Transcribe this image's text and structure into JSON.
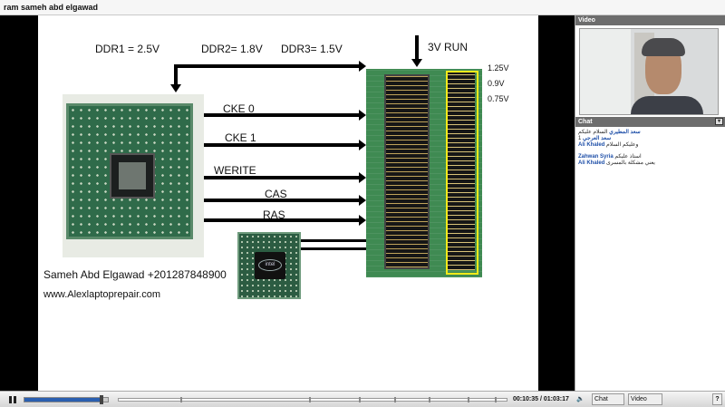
{
  "window": {
    "title": "ram sameh abd elgawad"
  },
  "slide": {
    "ddr1": "DDR1 = 2.5V",
    "ddr2": "DDR2= 1.8V",
    "ddr3": "DDR3= 1.5V",
    "run": "3V RUN",
    "volt_1": "1.25V",
    "volt_2": "0.9V",
    "volt_3": "0.75V",
    "signals": [
      "CKE 0",
      "CKE 1",
      "WERITE",
      "CAS",
      "RAS"
    ],
    "author": "Sameh Abd Elgawad +201287848900",
    "website": "www.Alexlaptoprepair.com",
    "chip_logo": "intel"
  },
  "panel": {
    "video_title": "Video",
    "chat_title": "Chat",
    "chat_messages": [
      {
        "user": "سعد المطيري",
        "text": "السلام عليكم"
      },
      {
        "user": "سعد العرجي",
        "text": "1"
      },
      {
        "user": "Ali Khaled",
        "text": "وعليكم السلام"
      },
      {
        "user": "Zahwan Syria",
        "text": "استاذ عليكم"
      },
      {
        "user": "Ali Khaled",
        "text": "يعني مشكلة بالمسرى"
      }
    ]
  },
  "controls": {
    "time": "00:10:35 / 01:03:17",
    "chat_label": "Chat",
    "video_label": "Video",
    "help_label": "?",
    "volume_level": 0.92,
    "seek_position": 0.17
  }
}
